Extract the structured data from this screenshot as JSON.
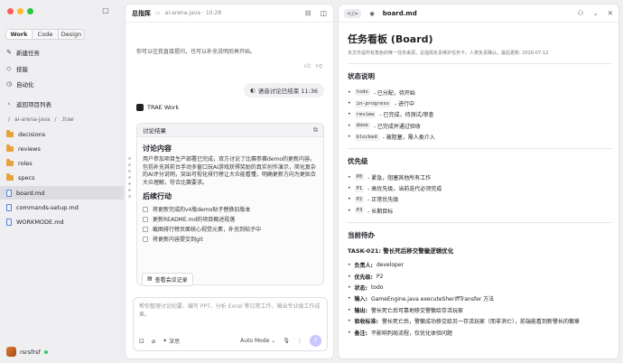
{
  "sidebar": {
    "tabs": [
      "Work",
      "Code",
      "Design"
    ],
    "nav": [
      {
        "icon": "new-task-icon",
        "label": "新建任务"
      },
      {
        "icon": "skills-icon",
        "label": "技能"
      },
      {
        "icon": "automation-icon",
        "label": "自动化"
      }
    ],
    "back_label": "返回项目列表",
    "crumbs": [
      "/",
      "ai-arena-java",
      "/",
      ".trae"
    ],
    "files": [
      {
        "type": "folder",
        "name": "decisions"
      },
      {
        "type": "folder",
        "name": "reviews"
      },
      {
        "type": "folder",
        "name": "roles"
      },
      {
        "type": "folder",
        "name": "specs"
      },
      {
        "type": "file",
        "name": "board.md",
        "selected": true
      },
      {
        "type": "file",
        "name": "commands-setup.md"
      },
      {
        "type": "file",
        "name": "WORKMODE.md"
      }
    ],
    "user": "rsrsfrsf"
  },
  "chat": {
    "title": "总指挥",
    "subtitle": "ai-arena-java · 10:28",
    "ai_top_text": "你可以往我直接提问，也可以补充说明后再开始。",
    "user_bubble": "语音讨论已结束 11:36",
    "agent_name": "TRAE Work",
    "card_title": "讨论结果",
    "section1": "讨论内容",
    "section1_text": "用户参加项目生产部署已完成，双方讨论了比赛参赛demo的更新内容。包括补充其前台手动多窗口玩AI游戏获得奖励的真实创作演示，简化复杂的AI评分说明，突出可视化排行榜让大众能看懂，明确更新方向为更贴合大众理解，符合比赛要求。",
    "section2": "后续行动",
    "todos": [
      "将更新完成的v4版demo贴子替换旧版本",
      "更新README.md的项目概述段落",
      "截图排行榜页面核心视觉元素，补充到帖子中",
      "将更新内容提交到git"
    ],
    "notes_button": "查看会议记录",
    "composer_placeholder": "帮你整理讨论纪要、编写 PPT、分析 Excel 等日常工作，输出专业级工作成果。",
    "think_label": "深思",
    "mode_label": "Auto Mode"
  },
  "doc": {
    "tab_code": "</>",
    "filename": "board.md",
    "title": "任务看板 (Board)",
    "meta": "本文件是所有角色的唯一任务来源，总指挥负责维护任务卡，人类负责确认。最后更新: 2026-07-12",
    "status_heading": "状态说明",
    "statuses": [
      {
        "code": "todo",
        "desc": "- 已分配，待开始"
      },
      {
        "code": "in-progress",
        "desc": "- 进行中"
      },
      {
        "code": "review",
        "desc": "- 已完成，待测试/审查"
      },
      {
        "code": "done",
        "desc": "- 已完成并通过验收"
      },
      {
        "code": "blocked",
        "desc": "- 被阻塞，需人类介入"
      }
    ],
    "priority_heading": "优先级",
    "priorities": [
      {
        "code": "P0",
        "desc": "- 紧急，阻塞其他所有工作"
      },
      {
        "code": "P1",
        "desc": "- 高优先级，当前迭代必须完成"
      },
      {
        "code": "P2",
        "desc": "- 正常优先级"
      },
      {
        "code": "P3",
        "desc": "- 长期目标"
      }
    ],
    "current_heading": "当前待办",
    "task_title": "TASK-021: 警长死后移交警徽逻辑优化",
    "task_fields": [
      {
        "k": "负责人:",
        "v": "developer"
      },
      {
        "k": "优先级:",
        "v": "P2"
      },
      {
        "k": "状态:",
        "v": "todo"
      },
      {
        "k": "输入:",
        "v": "GameEngine.java executeSheriffTransfer 方法"
      },
      {
        "k": "输出:",
        "v": "警长死亡后可靠地移交警徽给存活玩家"
      },
      {
        "k": "验收标准:",
        "v": "警长死亡后，警徽成功移交给另一存活玩家（而非消亡），前端能看到新警长的徽章"
      },
      {
        "k": "备注:",
        "v": "不影响判局流程，仅优化体验问题"
      }
    ]
  },
  "colors": {
    "accent": "#c9c6ff",
    "folder": "#e8a23a",
    "traffic_red": "#ff5f57",
    "traffic_yellow": "#febc2e",
    "traffic_green": "#28c840"
  }
}
